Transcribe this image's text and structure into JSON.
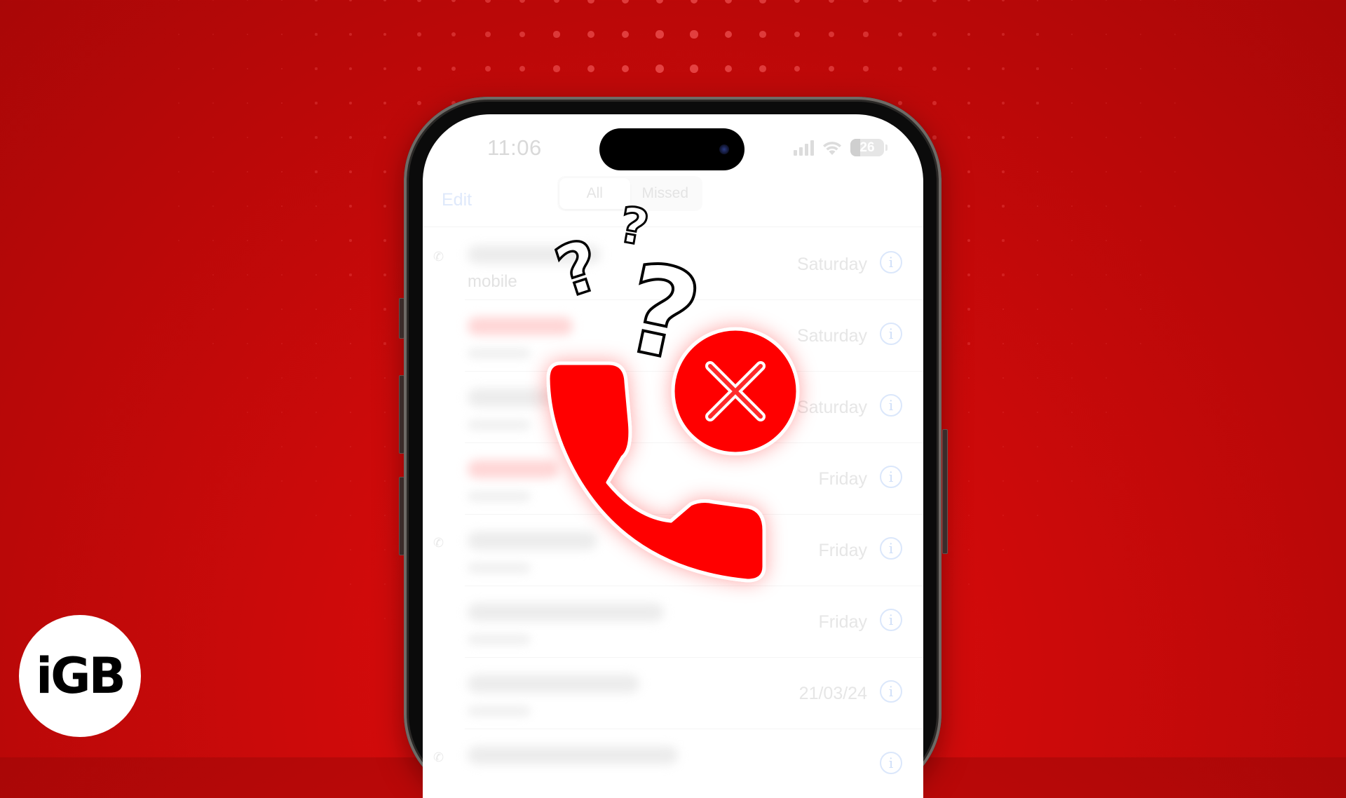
{
  "background": {
    "color": "#cc0a0a",
    "dot_color": "#ff6b6b"
  },
  "phone": {
    "status_bar": {
      "time": "11:06",
      "battery_level": "26",
      "signal_icon": "cellular-signal-icon",
      "wifi_icon": "wifi-icon"
    },
    "nav": {
      "edit_label": "Edit",
      "tabs": [
        {
          "label": "All",
          "active": true
        },
        {
          "label": "Missed",
          "active": false
        }
      ]
    },
    "recents": [
      {
        "name": "",
        "subtitle": "mobile",
        "date": "Saturday",
        "missed": false,
        "outgoing": true
      },
      {
        "name": "",
        "subtitle": "",
        "date": "Saturday",
        "missed": true,
        "outgoing": false
      },
      {
        "name": "",
        "subtitle": "",
        "date": "Saturday",
        "missed": false,
        "outgoing": false
      },
      {
        "name": "",
        "subtitle": "",
        "date": "Friday",
        "missed": true,
        "outgoing": false
      },
      {
        "name": "",
        "subtitle": "",
        "date": "Friday",
        "missed": false,
        "outgoing": true
      },
      {
        "name": "",
        "subtitle": "",
        "date": "Friday",
        "missed": false,
        "outgoing": false
      },
      {
        "name": "",
        "subtitle": "",
        "date": "21/03/24",
        "missed": false,
        "outgoing": false
      },
      {
        "name": "",
        "subtitle": "",
        "date": "",
        "missed": false,
        "outgoing": true
      }
    ]
  },
  "graphic": {
    "icon": "missed-call-phone-icon",
    "badge_icon": "close-circle-icon",
    "question_marks": [
      "?",
      "?",
      "?"
    ],
    "accent_color": "#ff0000"
  },
  "branding": {
    "logo_text": "iGB"
  }
}
